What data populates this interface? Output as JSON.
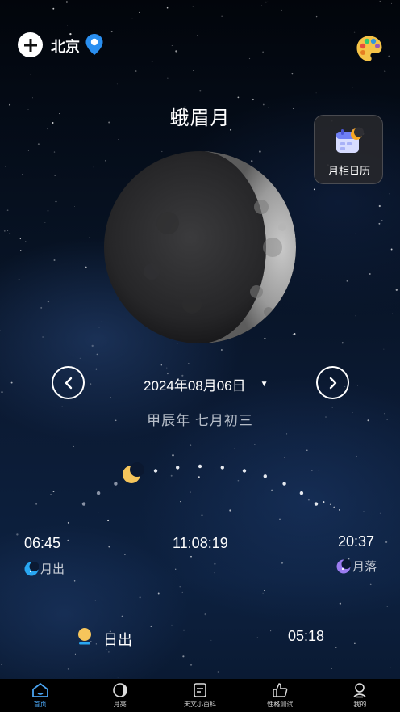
{
  "header": {
    "city": "北京",
    "add_icon": "plus-circle-icon",
    "location_icon": "location-pin-icon",
    "theme_icon": "palette-icon"
  },
  "moon": {
    "phase_name": "蛾眉月",
    "date": "2024年08月06日",
    "lunar_date": "甲辰年   七月初三"
  },
  "calendar_button": {
    "label": "月相日历",
    "icon": "calendar-moon-icon"
  },
  "times": {
    "moonrise": "06:45",
    "moonrise_label": "月出",
    "transit": "11:08:19",
    "moonset": "20:37",
    "moonset_label": "月落"
  },
  "sun": {
    "sunrise_label": "日出",
    "sunrise_time": "05:18"
  },
  "tabs": [
    {
      "label": "首页",
      "icon": "home-icon",
      "active": true
    },
    {
      "label": "月亮",
      "icon": "moon-phase-icon",
      "active": false
    },
    {
      "label": "天文小百科",
      "icon": "encyclopedia-icon",
      "active": false
    },
    {
      "label": "性格测试",
      "icon": "thumbs-up-icon",
      "active": false
    },
    {
      "label": "我的",
      "icon": "profile-icon",
      "active": false
    }
  ],
  "colors": {
    "accent": "#4aa3f0",
    "moonrise_icon": "#29a7f2",
    "moonset_icon": "#9b7cf0",
    "sun": "#f6c55b"
  }
}
